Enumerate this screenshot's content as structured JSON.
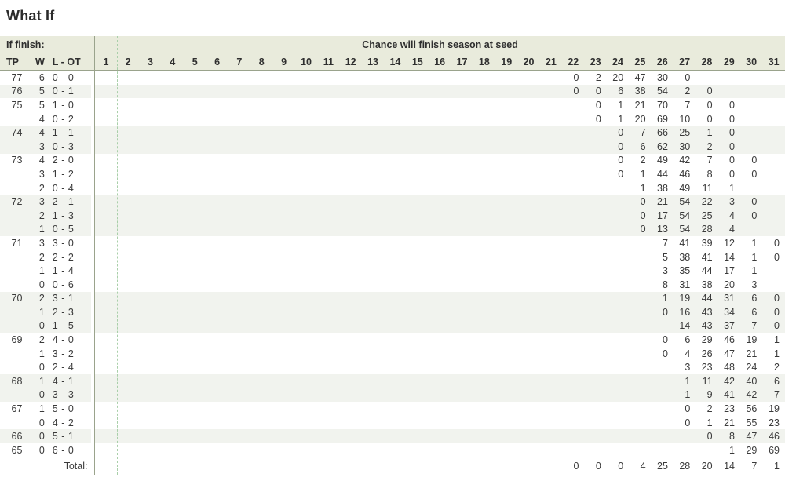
{
  "page": {
    "title": "What If"
  },
  "table": {
    "group_header_left": "If finish:",
    "group_header_right": "Chance will finish season at seed",
    "columns": {
      "tp": "TP",
      "w": "W",
      "lot": "L - OT"
    },
    "seeds": [
      "1",
      "2",
      "3",
      "4",
      "5",
      "6",
      "7",
      "8",
      "9",
      "10",
      "11",
      "12",
      "13",
      "14",
      "15",
      "16",
      "17",
      "18",
      "19",
      "20",
      "21",
      "22",
      "23",
      "24",
      "25",
      "26",
      "27",
      "28",
      "29",
      "30",
      "31"
    ],
    "total_label": "Total:",
    "rows": [
      {
        "tp": "77",
        "w": "6",
        "lot": "0 - 0",
        "shade": false,
        "values": {
          "22": "0",
          "23": "2",
          "24": "20",
          "25": "47",
          "26": "30",
          "27": "0"
        }
      },
      {
        "tp": "76",
        "w": "5",
        "lot": "0 - 1",
        "shade": true,
        "values": {
          "22": "0",
          "23": "0",
          "24": "6",
          "25": "38",
          "26": "54",
          "27": "2",
          "28": "0"
        }
      },
      {
        "tp": "75",
        "w": "5",
        "lot": "1 - 0",
        "shade": false,
        "values": {
          "23": "0",
          "24": "1",
          "25": "21",
          "26": "70",
          "27": "7",
          "28": "0",
          "29": "0"
        }
      },
      {
        "tp": "",
        "w": "4",
        "lot": "0 - 2",
        "shade": false,
        "values": {
          "23": "0",
          "24": "1",
          "25": "20",
          "26": "69",
          "27": "10",
          "28": "0",
          "29": "0"
        }
      },
      {
        "tp": "74",
        "w": "4",
        "lot": "1 - 1",
        "shade": true,
        "values": {
          "24": "0",
          "25": "7",
          "26": "66",
          "27": "25",
          "28": "1",
          "29": "0"
        }
      },
      {
        "tp": "",
        "w": "3",
        "lot": "0 - 3",
        "shade": true,
        "values": {
          "24": "0",
          "25": "6",
          "26": "62",
          "27": "30",
          "28": "2",
          "29": "0"
        }
      },
      {
        "tp": "73",
        "w": "4",
        "lot": "2 - 0",
        "shade": false,
        "values": {
          "24": "0",
          "25": "2",
          "26": "49",
          "27": "42",
          "28": "7",
          "29": "0",
          "30": "0"
        }
      },
      {
        "tp": "",
        "w": "3",
        "lot": "1 - 2",
        "shade": false,
        "values": {
          "24": "0",
          "25": "1",
          "26": "44",
          "27": "46",
          "28": "8",
          "29": "0",
          "30": "0"
        }
      },
      {
        "tp": "",
        "w": "2",
        "lot": "0 - 4",
        "shade": false,
        "values": {
          "25": "1",
          "26": "38",
          "27": "49",
          "28": "11",
          "29": "1"
        }
      },
      {
        "tp": "72",
        "w": "3",
        "lot": "2 - 1",
        "shade": true,
        "values": {
          "25": "0",
          "26": "21",
          "27": "54",
          "28": "22",
          "29": "3",
          "30": "0"
        }
      },
      {
        "tp": "",
        "w": "2",
        "lot": "1 - 3",
        "shade": true,
        "values": {
          "25": "0",
          "26": "17",
          "27": "54",
          "28": "25",
          "29": "4",
          "30": "0"
        }
      },
      {
        "tp": "",
        "w": "1",
        "lot": "0 - 5",
        "shade": true,
        "values": {
          "25": "0",
          "26": "13",
          "27": "54",
          "28": "28",
          "29": "4"
        }
      },
      {
        "tp": "71",
        "w": "3",
        "lot": "3 - 0",
        "shade": false,
        "values": {
          "26": "7",
          "27": "41",
          "28": "39",
          "29": "12",
          "30": "1",
          "31": "0"
        }
      },
      {
        "tp": "",
        "w": "2",
        "lot": "2 - 2",
        "shade": false,
        "values": {
          "26": "5",
          "27": "38",
          "28": "41",
          "29": "14",
          "30": "1",
          "31": "0"
        }
      },
      {
        "tp": "",
        "w": "1",
        "lot": "1 - 4",
        "shade": false,
        "values": {
          "26": "3",
          "27": "35",
          "28": "44",
          "29": "17",
          "30": "1"
        }
      },
      {
        "tp": "",
        "w": "0",
        "lot": "0 - 6",
        "shade": false,
        "values": {
          "26": "8",
          "27": "31",
          "28": "38",
          "29": "20",
          "30": "3"
        }
      },
      {
        "tp": "70",
        "w": "2",
        "lot": "3 - 1",
        "shade": true,
        "values": {
          "26": "1",
          "27": "19",
          "28": "44",
          "29": "31",
          "30": "6",
          "31": "0"
        }
      },
      {
        "tp": "",
        "w": "1",
        "lot": "2 - 3",
        "shade": true,
        "values": {
          "26": "0",
          "27": "16",
          "28": "43",
          "29": "34",
          "30": "6",
          "31": "0"
        }
      },
      {
        "tp": "",
        "w": "0",
        "lot": "1 - 5",
        "shade": true,
        "values": {
          "27": "14",
          "28": "43",
          "29": "37",
          "30": "7",
          "31": "0"
        }
      },
      {
        "tp": "69",
        "w": "2",
        "lot": "4 - 0",
        "shade": false,
        "values": {
          "26": "0",
          "27": "6",
          "28": "29",
          "29": "46",
          "30": "19",
          "31": "1"
        }
      },
      {
        "tp": "",
        "w": "1",
        "lot": "3 - 2",
        "shade": false,
        "values": {
          "26": "0",
          "27": "4",
          "28": "26",
          "29": "47",
          "30": "21",
          "31": "1"
        }
      },
      {
        "tp": "",
        "w": "0",
        "lot": "2 - 4",
        "shade": false,
        "values": {
          "27": "3",
          "28": "23",
          "29": "48",
          "30": "24",
          "31": "2"
        }
      },
      {
        "tp": "68",
        "w": "1",
        "lot": "4 - 1",
        "shade": true,
        "values": {
          "27": "1",
          "28": "11",
          "29": "42",
          "30": "40",
          "31": "6"
        }
      },
      {
        "tp": "",
        "w": "0",
        "lot": "3 - 3",
        "shade": true,
        "values": {
          "27": "1",
          "28": "9",
          "29": "41",
          "30": "42",
          "31": "7"
        }
      },
      {
        "tp": "67",
        "w": "1",
        "lot": "5 - 0",
        "shade": false,
        "values": {
          "27": "0",
          "28": "2",
          "29": "23",
          "30": "56",
          "31": "19"
        }
      },
      {
        "tp": "",
        "w": "0",
        "lot": "4 - 2",
        "shade": false,
        "values": {
          "27": "0",
          "28": "1",
          "29": "21",
          "30": "55",
          "31": "23"
        }
      },
      {
        "tp": "66",
        "w": "0",
        "lot": "5 - 1",
        "shade": true,
        "values": {
          "28": "0",
          "29": "8",
          "30": "47",
          "31": "46"
        }
      },
      {
        "tp": "65",
        "w": "0",
        "lot": "6 - 0",
        "shade": false,
        "values": {
          "29": "1",
          "30": "29",
          "31": "69"
        }
      }
    ],
    "totals": {
      "22": "0",
      "23": "0",
      "24": "0",
      "25": "4",
      "26": "25",
      "27": "28",
      "28": "20",
      "29": "14",
      "30": "7",
      "31": "1"
    }
  },
  "guides": {
    "green_after_seed": "1",
    "red_after_seed": "16"
  },
  "colors": {
    "header_bg": "#e9ebdc",
    "row_shade": "#f1f3ee",
    "rule": "#9aa38c",
    "green_dash": "#a9cfa9",
    "red_dash": "#e3b3b3"
  }
}
